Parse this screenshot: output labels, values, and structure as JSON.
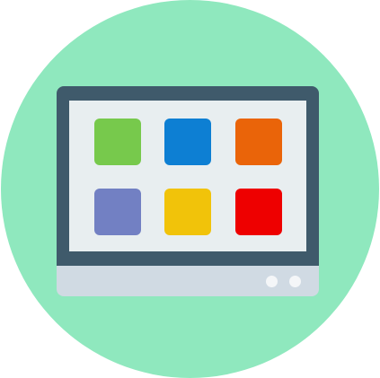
{
  "icon": {
    "name": "app-launcher-monitor-icon",
    "colors": {
      "circle": "#8FE8BE",
      "bezel": "#3F5A6B",
      "screen": "#E8EEF0",
      "base": "#D0DAE3",
      "dots": "#F4F6F8"
    },
    "tiles": [
      {
        "name": "green-app-tile",
        "color": "#77C94C"
      },
      {
        "name": "blue-app-tile",
        "color": "#0D7FD3"
      },
      {
        "name": "orange-app-tile",
        "color": "#EA6409"
      },
      {
        "name": "purple-app-tile",
        "color": "#7280C3"
      },
      {
        "name": "yellow-app-tile",
        "color": "#F1C30A"
      },
      {
        "name": "red-app-tile",
        "color": "#EE0000"
      }
    ]
  }
}
